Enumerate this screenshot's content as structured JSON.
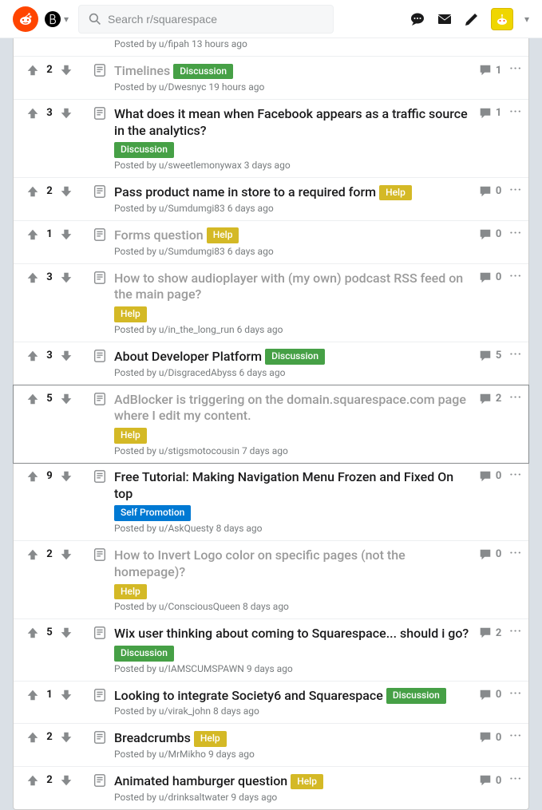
{
  "search_placeholder": "Search r/squarespace",
  "partial_top": {
    "by": "Posted by",
    "author": "u/fipah",
    "age": "13 hours ago"
  },
  "by_label": "Posted by",
  "more_label": "···",
  "posts": [
    {
      "score": "2",
      "title": "Timelines",
      "flair": "Discussion",
      "flair_color": "#46a046",
      "author": "u/Dwesnyc",
      "age": "19 hours ago",
      "comments": "1",
      "visited": true
    },
    {
      "score": "3",
      "title": "What does it mean when Facebook appears as a traffic source in the analytics?",
      "flair": "Discussion",
      "flair_color": "#46a046",
      "author": "u/sweetlemonywax",
      "age": "3 days ago",
      "comments": "1",
      "visited": false
    },
    {
      "score": "2",
      "title": "Pass product name in store to a required form",
      "flair": "Help",
      "flair_color": "#d4b926",
      "author": "u/Sumdumgi83",
      "age": "6 days ago",
      "comments": "0",
      "visited": false
    },
    {
      "score": "1",
      "title": "Forms question",
      "flair": "Help",
      "flair_color": "#d4b926",
      "author": "u/Sumdumgi83",
      "age": "6 days ago",
      "comments": "0",
      "visited": true
    },
    {
      "score": "3",
      "title": "How to show audioplayer with (my own) podcast RSS feed on the main page?",
      "flair": "Help",
      "flair_color": "#d4b926",
      "author": "u/in_the_long_run",
      "age": "6 days ago",
      "comments": "0",
      "visited": true
    },
    {
      "score": "3",
      "title": "About Developer Platform",
      "flair": "Discussion",
      "flair_color": "#46a046",
      "author": "u/DisgracedAbyss",
      "age": "6 days ago",
      "comments": "5",
      "visited": false
    },
    {
      "score": "5",
      "title": "AdBlocker is triggering on the domain.squarespace.com page where I edit my content.",
      "flair": "Help",
      "flair_color": "#d4b926",
      "author": "u/stigsmotocousin",
      "age": "7 days ago",
      "comments": "2",
      "visited": true,
      "highlight": true
    },
    {
      "score": "9",
      "title": "Free Tutorial: Making Navigation Menu Frozen and Fixed On top",
      "flair": "Self Promotion",
      "flair_color": "#0079d3",
      "author": "u/AskQuesty",
      "age": "8 days ago",
      "comments": "0",
      "visited": false
    },
    {
      "score": "2",
      "title": "How to Invert Logo color on specific pages (not the homepage)?",
      "flair": "Help",
      "flair_color": "#d4b926",
      "author": "u/ConsciousQueen",
      "age": "8 days ago",
      "comments": "0",
      "visited": true
    },
    {
      "score": "5",
      "title": "Wix user thinking about coming to Squarespace... should i go?",
      "flair": "Discussion",
      "flair_color": "#46a046",
      "author": "u/IAMSCUMSPAWN",
      "age": "9 days ago",
      "comments": "2",
      "visited": false
    },
    {
      "score": "1",
      "title": "Looking to integrate Society6 and Squarespace",
      "flair": "Discussion",
      "flair_color": "#46a046",
      "author": "u/virak_john",
      "age": "8 days ago",
      "comments": "0",
      "visited": false
    },
    {
      "score": "2",
      "title": "Breadcrumbs",
      "flair": "Help",
      "flair_color": "#d4b926",
      "author": "u/MrMikho",
      "age": "9 days ago",
      "comments": "0",
      "visited": false
    },
    {
      "score": "2",
      "title": "Animated hamburger question",
      "flair": "Help",
      "flair_color": "#d4b926",
      "author": "u/drinksaltwater",
      "age": "9 days ago",
      "comments": "0",
      "visited": false
    }
  ]
}
